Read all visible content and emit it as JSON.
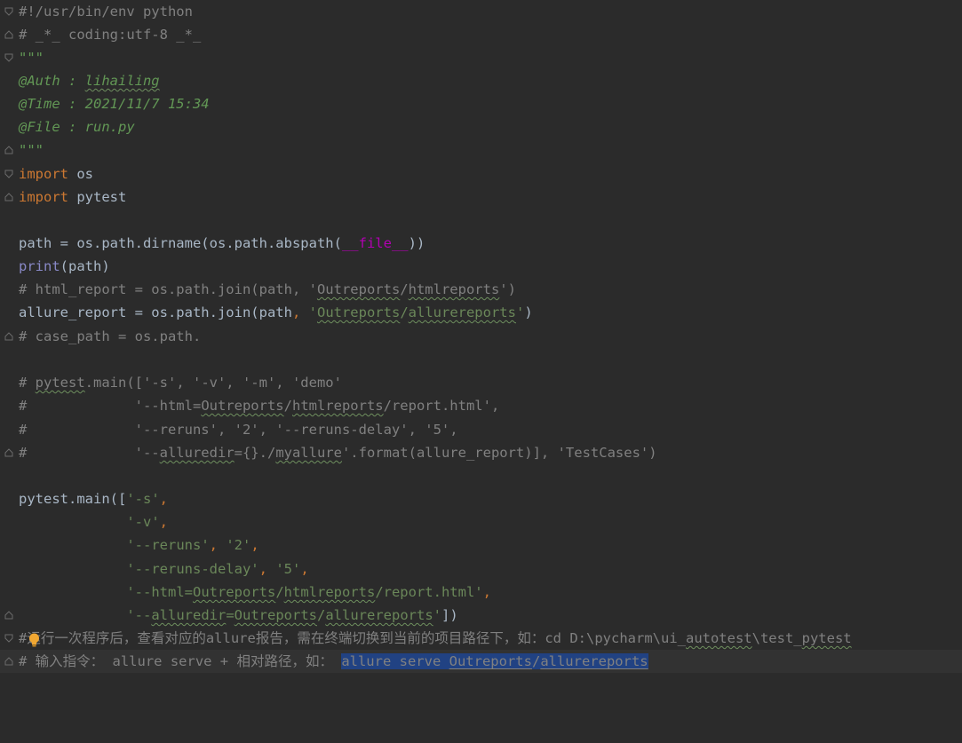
{
  "file": {
    "shebang": "#!/usr/bin/env python",
    "coding": "# _*_ coding:utf-8 _*_",
    "doc_open": "\"\"\"",
    "doc_auth_label": "@Auth : ",
    "doc_auth_value": "lihailing",
    "doc_time": "@Time : 2021/11/7 15:34",
    "doc_file": "@File : run.py",
    "doc_close": "\"\"\"",
    "import_kw": "import",
    "import_os": " os",
    "import_pytest": " pytest",
    "path_lhs": "path = os.path.dirname(os.path.abspath(",
    "dunder_file": "__file__",
    "path_rhs": "))",
    "print_kw": "print",
    "print_args": "(path)",
    "c_html_1": "# html_report = os.path.join(path, '",
    "c_outreports": "Outreports",
    "slash": "/",
    "c_htmlreports": "htmlreports",
    "c_html_2": "')",
    "allure_lhs": "allure_report = os.path.join(path",
    "comma": ",",
    "space": " ",
    "quote": "'",
    "allurereports": "allurereports",
    "close_paren": ")",
    "c_case": "# case_path = os.path.",
    "c_main_1": "# ",
    "c_pytest": "pytest",
    "c_main_2": ".main(['-s', '-v', '-m', 'demo'",
    "c_html_line_1": "#             '--html=",
    "c_html_line_2": "/report.html',",
    "c_reruns": "#             '--reruns', '2', '--reruns-delay', '5',",
    "c_alluredir_1": "#             '--",
    "c_alluredir": "alluredir",
    "c_alluredir_2": "={}./",
    "c_myallure": "myallure",
    "c_alluredir_3": "'.format(allure_report)], 'TestCases')",
    "main_lhs": "pytest.main([",
    "s_arg": "'-s'",
    "indent": "             ",
    "v_arg": "'-v'",
    "reruns_arg": "'--reruns'",
    "two": "'2'",
    "delay_arg": "'--reruns-delay'",
    "five": "'5'",
    "html_arg_1": "'--html=",
    "html_arg_2": "/report.html'",
    "alluredir_1": "'--",
    "alluredir_arg": "alluredir",
    "eq": "=",
    "bracket_close": "])",
    "note_hash": "#",
    "note_1": "运行一次程序后，查看对应的allure报告，需在终端切换到当前的项目路径下，如：cd D:\\pycharm\\ui_",
    "note_autotest": "autotest",
    "note_2": "\\test_",
    "note_pytest": "pytest",
    "cmd_1": "# 输入指令： allure serve + 相对路径，如： ",
    "cmd_sel_1": "allure serve ",
    "cmd_sel_outreports": "Outreports",
    "cmd_sel_slash": "/",
    "cmd_sel_allurereports": "allurereports"
  }
}
